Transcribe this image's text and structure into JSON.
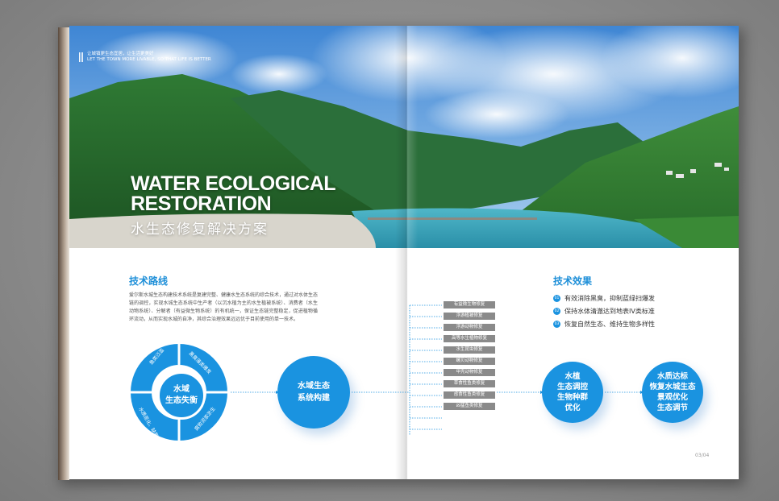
{
  "tagline": {
    "cn": "让城镇更生态宜居，让生活更美好",
    "en": "LET THE TOWN MORE LIVABLE, SO THAT LIFE IS BETTER"
  },
  "hero": {
    "title_en_line1": "WATER ECOLOGICAL",
    "title_en_line2": "RESTORATION",
    "title_cn": "水生态修复解决方案"
  },
  "tech_route": {
    "heading": "技术路线",
    "body": "爱尔斯水城生态构建技术系统是复建完整、健康水生态系统的综合技术，通过对水体生态链的调控，实现水城生态系统中生产者（以沉水植为主的水生植被系统）、消费者（水生动物系统）、分解者（有益微生物系统）的有机统一，保证生态链完整稳定，促进植物循环流动，从而实现水城的自净，其综合治理效果远远优于目前使用的单一技术。"
  },
  "ring": {
    "center_line1": "水域",
    "center_line2": "生态失衡",
    "segments": [
      "鱼类泛滥",
      "黑臭藻类爆发",
      "水质恶化、缺氧",
      "腐败泥浆淤生"
    ]
  },
  "build": {
    "line1": "水域生态",
    "line2": "系统构建"
  },
  "restoration_items": [
    "有益微生物修复",
    "浮游植被修复",
    "浮游动物修复",
    "高等水生植物修复",
    "水生昆虫修复",
    "螺贝动物修复",
    "甲壳动物修复",
    "草食性鱼类修复",
    "虑食性鱼类修复",
    "凶猛鱼类修复"
  ],
  "effects": {
    "heading": "技术效果",
    "items": [
      {
        "num": "01",
        "text": "有效消除黑臭，抑制蓝绿扫爆发"
      },
      {
        "num": "02",
        "text": "保持水体清澈达到地表IV类标准"
      },
      {
        "num": "03",
        "text": "恢复自然生态、维持生物多样性"
      }
    ]
  },
  "result_a": {
    "lines": [
      "水植",
      "生态调控",
      "生物种群",
      "优化"
    ]
  },
  "result_b": {
    "lines": [
      "水质达标",
      "恢复水城生态",
      "景观优化",
      "生态调节"
    ]
  },
  "page_number": "03/04",
  "colors": {
    "accent": "#1a93e0",
    "tag_gray": "#8a8a8a"
  }
}
